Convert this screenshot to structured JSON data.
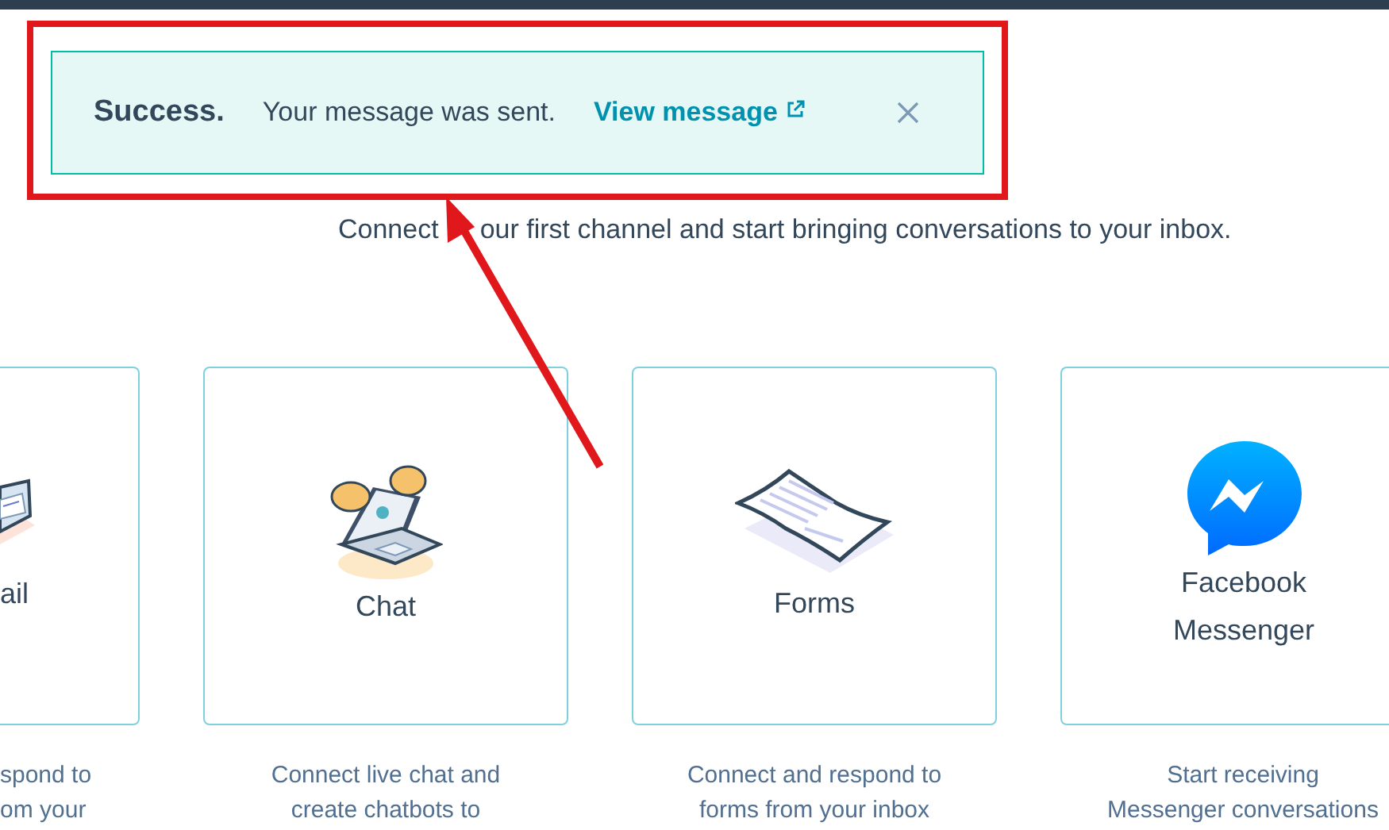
{
  "alert": {
    "kind": "success",
    "title": "Success.",
    "message": "Your message was sent.",
    "link": "View message"
  },
  "intro": [
    "Connect",
    "our first channel and start bringing conversations to your inbox."
  ],
  "channels": [
    {
      "kind": "email",
      "clipped_left": true,
      "clipped_right": false,
      "label": "ail",
      "description": [
        "spond to",
        "om your"
      ]
    },
    {
      "kind": "chat",
      "clipped_left": false,
      "clipped_right": false,
      "label": "Chat",
      "description": [
        "Connect live chat and",
        "create chatbots to"
      ]
    },
    {
      "kind": "forms",
      "clipped_left": false,
      "clipped_right": false,
      "label": "Forms",
      "description": [
        "Connect and respond to",
        "forms from your inbox"
      ]
    },
    {
      "kind": "messenger",
      "clipped_left": false,
      "clipped_right": true,
      "label": "Facebook Messenger",
      "description": [
        "Start receiving",
        "Messenger conversations"
      ]
    }
  ]
}
